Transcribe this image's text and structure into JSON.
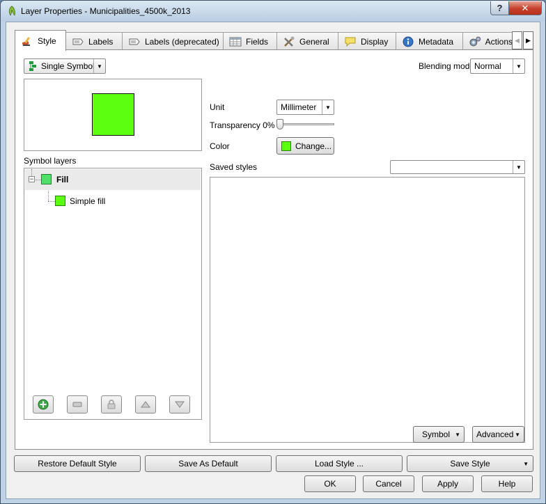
{
  "window": {
    "title": "Layer Properties - Municipalities_4500k_2013",
    "help_label": "?",
    "close_label": "✕"
  },
  "tabs": [
    {
      "label": "Style",
      "icon": "paintbrush-icon"
    },
    {
      "label": "Labels",
      "icon": "labels-icon"
    },
    {
      "label": "Labels (deprecated)",
      "icon": "labels-deprecated-icon"
    },
    {
      "label": "Fields",
      "icon": "table-icon"
    },
    {
      "label": "General",
      "icon": "tools-icon"
    },
    {
      "label": "Display",
      "icon": "speech-bubble-icon"
    },
    {
      "label": "Metadata",
      "icon": "info-icon"
    },
    {
      "label": "Actions",
      "icon": "gears-icon"
    }
  ],
  "style": {
    "renderer": "Single Symbol",
    "blending_label": "Blending mode",
    "blending_value": "Normal",
    "symbol_layers_label": "Symbol layers",
    "tree": {
      "root": "Fill",
      "child": "Simple fill"
    },
    "unit_label": "Unit",
    "unit_value": "Millimeter",
    "transparency_label": "Transparency 0%",
    "transparency_value": 0,
    "color_label": "Color",
    "color_button": "Change...",
    "saved_styles_label": "Saved styles",
    "saved_styles_value": "",
    "symbol_button": "Symbol",
    "advanced_button": "Advanced",
    "fill_color": "#5cff10"
  },
  "footer": {
    "restore": "Restore Default Style",
    "save_default": "Save As Default",
    "load_style": "Load Style ...",
    "save_style": "Save Style",
    "ok": "OK",
    "cancel": "Cancel",
    "apply": "Apply",
    "help": "Help"
  }
}
